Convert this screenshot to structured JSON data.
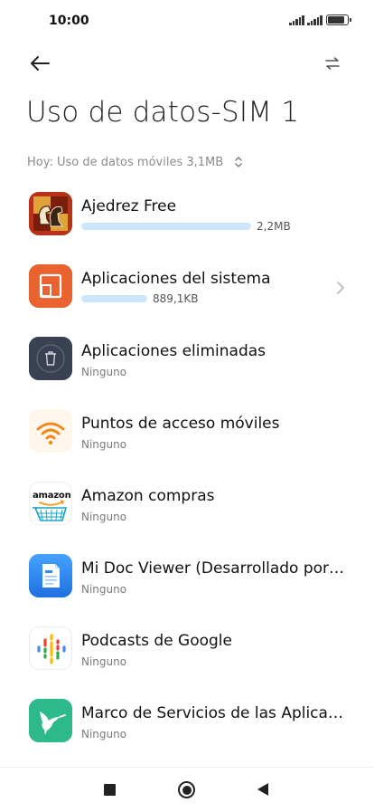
{
  "status_bar": {
    "time": "10:00",
    "icons": [
      "signal-icon",
      "signal-icon",
      "battery-icon"
    ]
  },
  "header": {
    "title": "Uso de datos-SIM 1",
    "back_icon": "arrow-left-icon",
    "action_icon": "swap-arrows-icon"
  },
  "filter": {
    "label": "Hoy: Uso de datos móviles 3,1MB",
    "icon": "up-down-chevron-icon"
  },
  "apps": [
    {
      "name": "Ajedrez Free",
      "value": "2,2MB",
      "usage_fraction": 1.0,
      "icon": "chess-icon"
    },
    {
      "name": "Aplicaciones del sistema",
      "value": "889,1KB",
      "usage_fraction": 0.39,
      "icon": "system-apps-icon",
      "has_chevron": true
    },
    {
      "name": "Aplicaciones eliminadas",
      "value": "Ninguno",
      "icon": "trash-icon"
    },
    {
      "name": "Puntos de acceso móviles",
      "value": "Ninguno",
      "icon": "wifi-hotspot-icon"
    },
    {
      "name": "Amazon compras",
      "value": "Ninguno",
      "icon": "amazon-icon"
    },
    {
      "name": "Mi Doc Viewer (Desarrollado por…",
      "value": "Ninguno",
      "icon": "doc-viewer-icon"
    },
    {
      "name": "Podcasts de Google",
      "value": "Ninguno",
      "icon": "google-podcasts-icon"
    },
    {
      "name": "Marco de Servicios de las Aplica…",
      "value": "Ninguno",
      "icon": "hummingbird-icon"
    }
  ],
  "navigation": {
    "icons": [
      "recents-square-icon",
      "home-circle-icon",
      "back-triangle-icon"
    ]
  },
  "colors": {
    "usage_bar": "#cde6fb",
    "secondary_text": "#8b8b8b"
  }
}
